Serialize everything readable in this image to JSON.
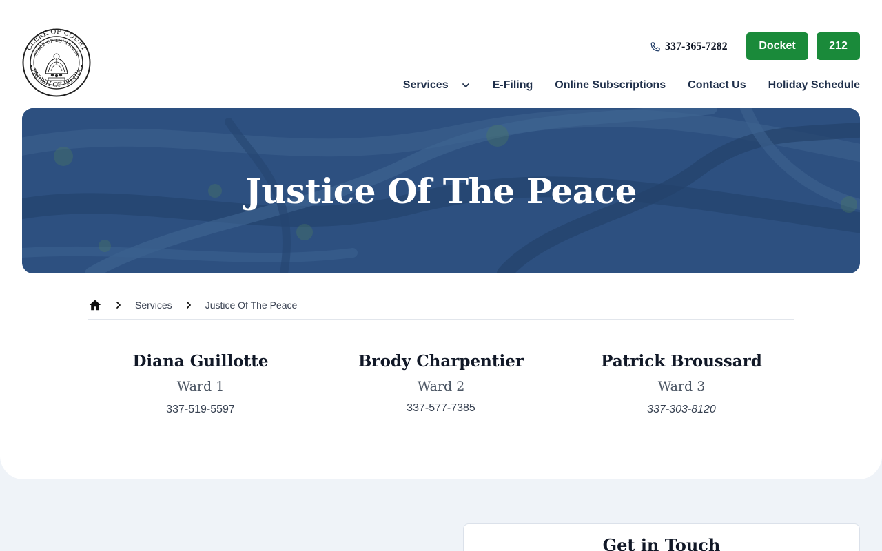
{
  "header": {
    "logo_alt": "Clerk of Court seal, Parish of Iberia",
    "phone": "337-365-7282",
    "docket_label": "Docket",
    "btn212_label": "212"
  },
  "nav": [
    {
      "label": "Services",
      "has_dropdown": true
    },
    {
      "label": "E-Filing"
    },
    {
      "label": "Online Subscriptions"
    },
    {
      "label": "Contact Us"
    },
    {
      "label": "Holiday Schedule"
    }
  ],
  "hero": {
    "title": "Justice Of The Peace"
  },
  "breadcrumb": {
    "items": [
      "Services",
      "Justice Of The Peace"
    ]
  },
  "people": [
    {
      "name": "Diana Guillotte",
      "ward": "Ward 1",
      "phone": "337-519-5597"
    },
    {
      "name": "Brody Charpentier",
      "ward": "Ward 2",
      "phone": "337-577-7385"
    },
    {
      "name": "Patrick Broussard",
      "ward": "Ward 3",
      "phone": "337-303-8120"
    }
  ],
  "contact_card": {
    "title": "Get in Touch"
  },
  "colors": {
    "accent_green": "#1a8a3a",
    "hero_blue": "#2c4f7e",
    "nav_text": "#1f2f4a"
  }
}
